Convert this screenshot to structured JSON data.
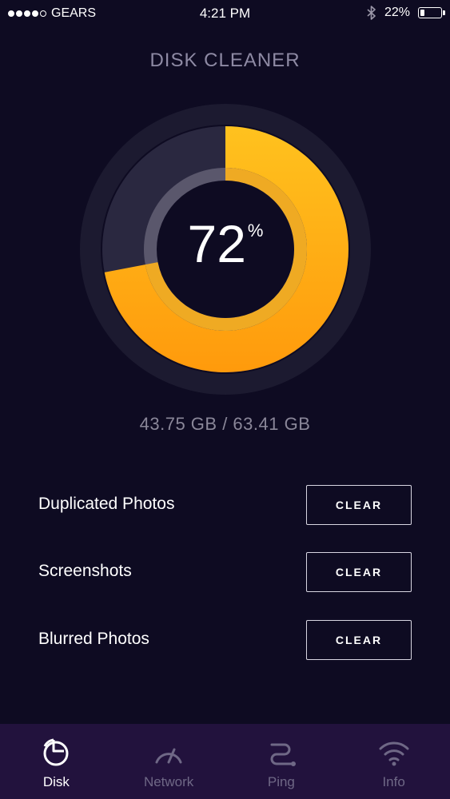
{
  "status_bar": {
    "carrier": "GEARS",
    "time": "4:21 PM",
    "battery_text": "22%",
    "battery_level": 0.22,
    "signal_bars_filled": 4,
    "signal_bars_total": 5,
    "icons": [
      "signal-dots-icon",
      "bluetooth-icon",
      "battery-icon"
    ]
  },
  "header": {
    "title": "DISK CLEANER"
  },
  "gauge": {
    "value": "72",
    "unit": "%",
    "fraction": 0.72,
    "accent_color": "#ffb21a",
    "track_color": "#2a2840"
  },
  "usage": {
    "text": "43.75 GB / 63.41 GB"
  },
  "items": [
    {
      "label": "Duplicated Photos",
      "button": "CLEAR"
    },
    {
      "label": "Screenshots",
      "button": "CLEAR"
    },
    {
      "label": "Blurred Photos",
      "button": "CLEAR"
    }
  ],
  "tabs": [
    {
      "label": "Disk",
      "icon": "disk-pie-icon",
      "active": true
    },
    {
      "label": "Network",
      "icon": "speedometer-icon",
      "active": false
    },
    {
      "label": "Ping",
      "icon": "ping-path-icon",
      "active": false
    },
    {
      "label": "Info",
      "icon": "wifi-icon",
      "active": false
    }
  ],
  "colors": {
    "background": "#0e0b22",
    "tabbar": "#22123d",
    "accent": "#ffb21a",
    "muted_text": "#8a8799"
  }
}
